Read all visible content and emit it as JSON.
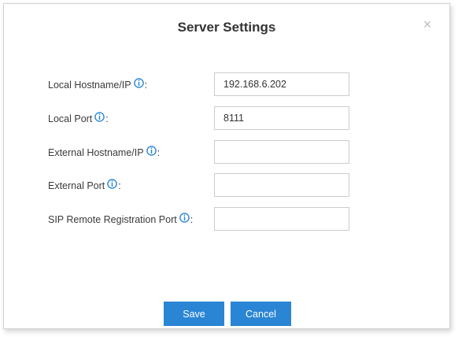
{
  "dialog": {
    "title": "Server Settings",
    "close_label": "×"
  },
  "fields": [
    {
      "label": "Local Hostname/IP",
      "suffix": ":",
      "value": "192.168.6.202"
    },
    {
      "label": "Local Port",
      "suffix": ":",
      "value": "8111"
    },
    {
      "label": "External Hostname/IP",
      "suffix": ":",
      "value": ""
    },
    {
      "label": "External Port",
      "suffix": ":",
      "value": ""
    },
    {
      "label": "SIP Remote Registration Port",
      "suffix": ":",
      "value": ""
    }
  ],
  "buttons": {
    "save": "Save",
    "cancel": "Cancel"
  },
  "colors": {
    "accent": "#2a85d5",
    "info_icon": "#2a85d5"
  },
  "icons": {
    "info": "info-circle-icon",
    "close": "close-icon"
  }
}
